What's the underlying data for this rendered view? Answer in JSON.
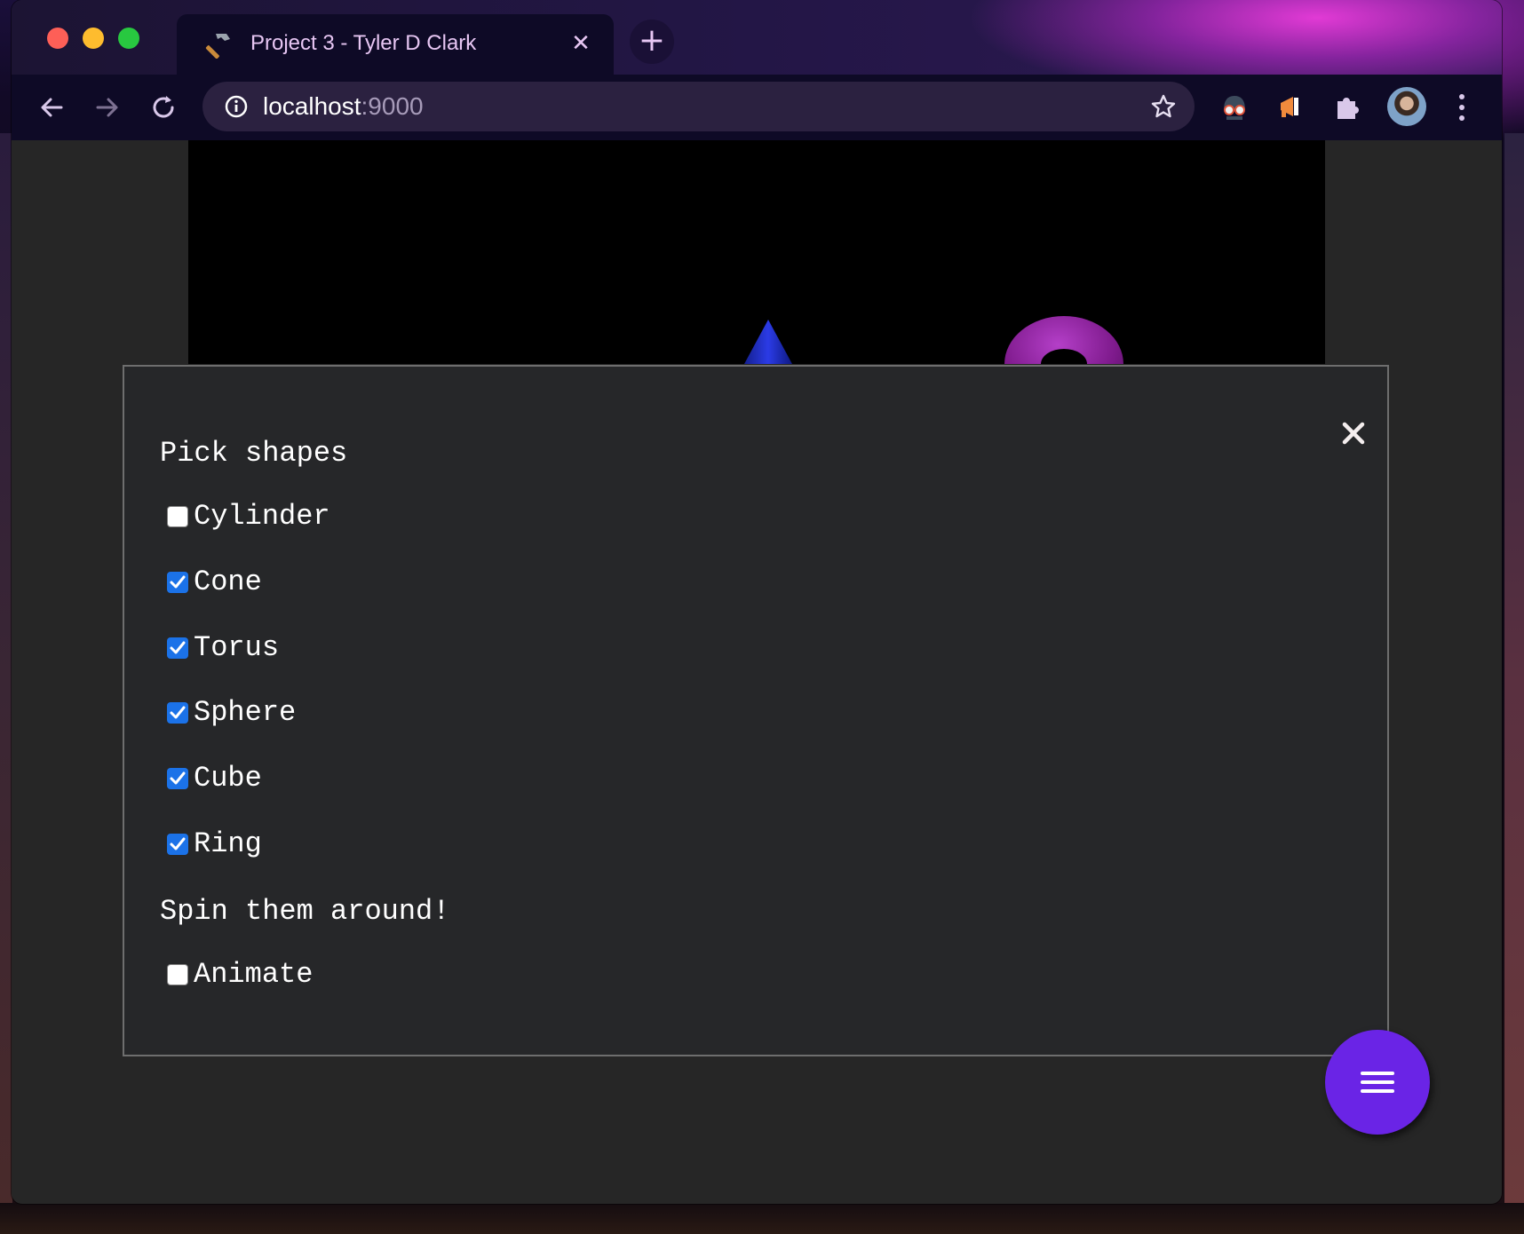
{
  "browser": {
    "tab": {
      "title": "Project 3 - Tyler D Clark",
      "close_glyph": "✕",
      "icon": "hammer-icon"
    },
    "new_tab_glyph": "+",
    "address": {
      "host": "localhost",
      "port": ":9000"
    },
    "icons": [
      "back-icon",
      "forward-icon",
      "reload-icon",
      "info-icon",
      "star-icon",
      "extension-spy-icon",
      "extension-megaphone-icon",
      "puzzle-icon",
      "avatar",
      "menu-icon"
    ]
  },
  "scene": {
    "shapes_visible": [
      "cone",
      "torus"
    ],
    "colors": {
      "cone": "#1d2ed1",
      "torus": "#8e1e9e",
      "background": "#000000"
    }
  },
  "panel": {
    "heading_shapes": "Pick shapes",
    "options": [
      {
        "label": "Cylinder",
        "checked": false
      },
      {
        "label": "Cone",
        "checked": true
      },
      {
        "label": "Torus",
        "checked": true
      },
      {
        "label": "Sphere",
        "checked": true
      },
      {
        "label": "Cube",
        "checked": true
      },
      {
        "label": "Ring",
        "checked": true
      }
    ],
    "heading_spin": "Spin them around!",
    "animate": {
      "label": "Animate",
      "checked": false
    }
  },
  "fab": {
    "icon": "hamburger-icon",
    "color": "#6a24e6"
  },
  "accent": "#1b72e8"
}
